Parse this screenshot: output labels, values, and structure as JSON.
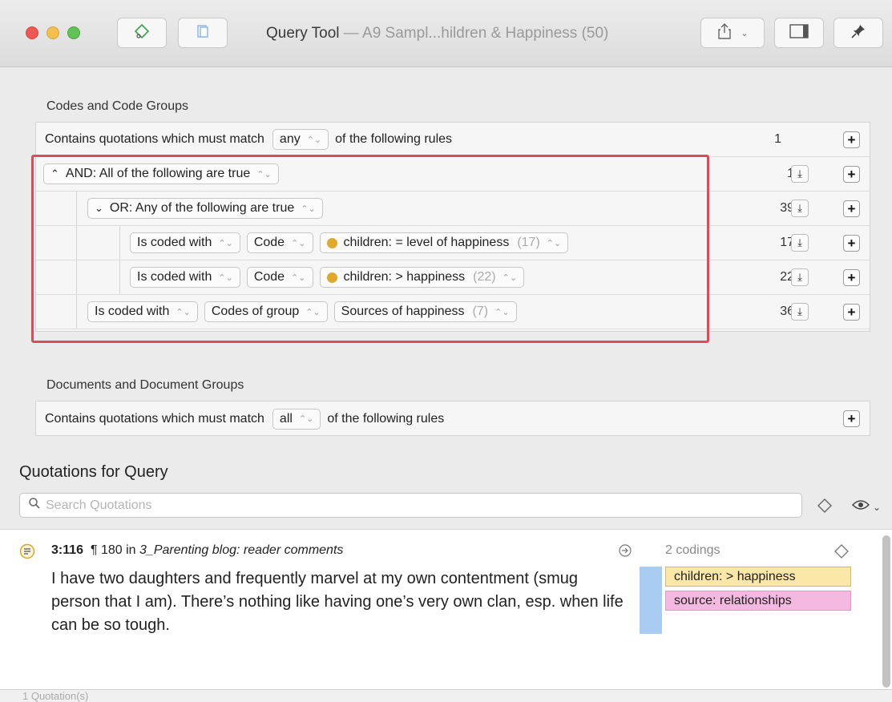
{
  "window": {
    "title_main": "Query Tool",
    "title_sub": " — A9 Sampl...hildren & Happiness (50)"
  },
  "codes_section": {
    "label": "Codes and Code Groups",
    "top_rule": {
      "prefix": "Contains quotations which must match",
      "mode": "any",
      "suffix": "of the following rules",
      "count": "1"
    },
    "and_rule": {
      "label": "AND: All of the following are true",
      "count": "1"
    },
    "or_rule": {
      "label": "OR: Any of the following are true",
      "count": "39"
    },
    "rule1": {
      "op": "Is coded with",
      "type": "Code",
      "value": "children: = level of happiness",
      "value_count": "(17)",
      "count": "17"
    },
    "rule2": {
      "op": "Is coded with",
      "type": "Code",
      "value": "children: > happiness",
      "value_count": "(22)",
      "count": "22"
    },
    "rule3": {
      "op": "Is coded with",
      "type": "Codes of group",
      "value": "Sources of happiness",
      "value_count": "(7)",
      "count": "36"
    }
  },
  "documents_section": {
    "label": "Documents and Document Groups",
    "rule": {
      "prefix": "Contains quotations which must match",
      "mode": "all",
      "suffix": "of the following rules"
    }
  },
  "quotations": {
    "title": "Quotations for Query",
    "search_placeholder": "Search Quotations",
    "items": [
      {
        "id": "3:116",
        "meta": "¶ 180 in ",
        "doc": "3_Parenting blog: reader comments",
        "text": "I have two daughters and frequently marvel at my own contentment (smug person that I am). There’s nothing like having one’s very own clan, esp. when life can be so tough.",
        "codings_label": "2 codings",
        "codes": [
          {
            "label": "children: > happiness",
            "color": "#fbe7a8"
          },
          {
            "label": "source: relationships",
            "color": "#f5b8e0"
          }
        ]
      }
    ],
    "footer": "1 Quotation(s)"
  },
  "colors": {
    "highlight": "#e04a57",
    "code_dot": "#e0a82c",
    "coding_bar": "#a9cdf2"
  },
  "icons": [
    "diamond-tag-icon",
    "document-icon",
    "share-icon",
    "sidebar-icon",
    "pin-icon",
    "download-icon",
    "plus-icon",
    "search-icon",
    "eye-icon",
    "quote-icon",
    "go-arrow-icon"
  ]
}
